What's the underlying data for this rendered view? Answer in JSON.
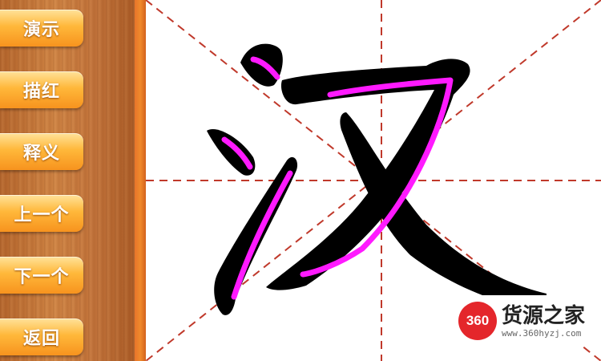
{
  "menu": {
    "items": [
      {
        "label": "演示"
      },
      {
        "label": "描红"
      },
      {
        "label": "释义"
      },
      {
        "label": "上一个"
      },
      {
        "label": "下一个"
      },
      {
        "label": "返回"
      }
    ]
  },
  "practice": {
    "character": "汉",
    "grid": "米字格",
    "grid_color": "#c0392b",
    "stroke_color": "#000000",
    "trace_color": "#ff1aff"
  },
  "watermark": {
    "logo": "360",
    "title": "货源之家",
    "url": "www.360hyzj.com",
    "logo_color": "#e4262b"
  }
}
